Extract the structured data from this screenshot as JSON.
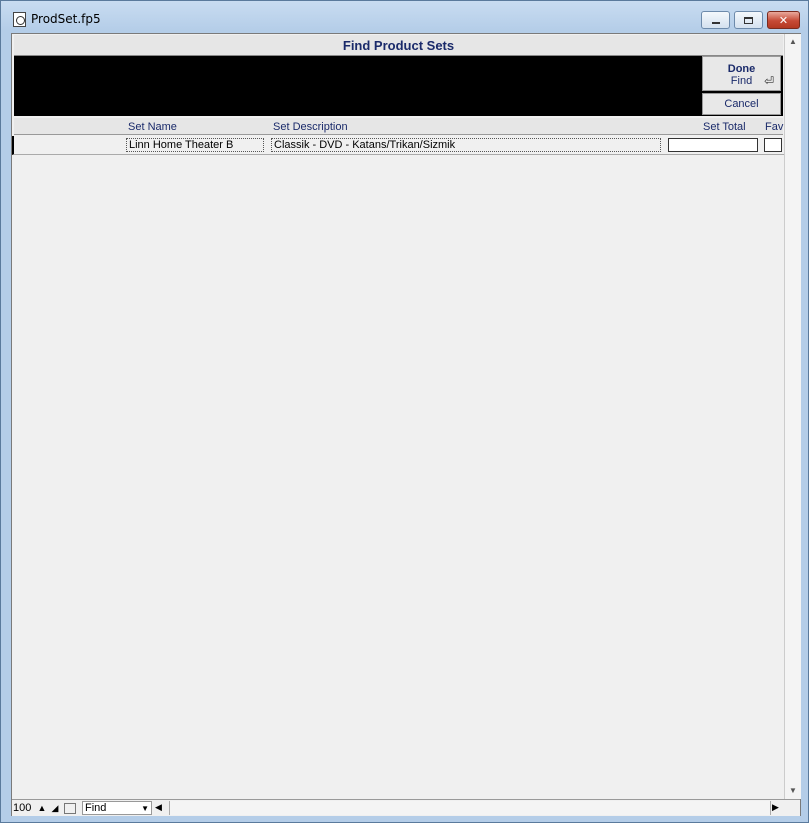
{
  "window": {
    "title": "ProdSet.fp5"
  },
  "layout": {
    "header_title": "Find Product Sets"
  },
  "buttons": {
    "done_line1": "Done",
    "done_line2": "Find",
    "cancel": "Cancel"
  },
  "columns": {
    "set_name": "Set Name",
    "set_description": "Set Description",
    "set_total": "Set Total",
    "fav": "Fav"
  },
  "row": {
    "set_name": "Linn Home Theater B",
    "set_description": "Classik - DVD - Katans/Trikan/Sizmik",
    "set_total": "",
    "fav": ""
  },
  "statusbar": {
    "zoom": "100",
    "mode": "Find"
  },
  "icons": {
    "app": "document-icon",
    "enter": "enter-icon"
  }
}
